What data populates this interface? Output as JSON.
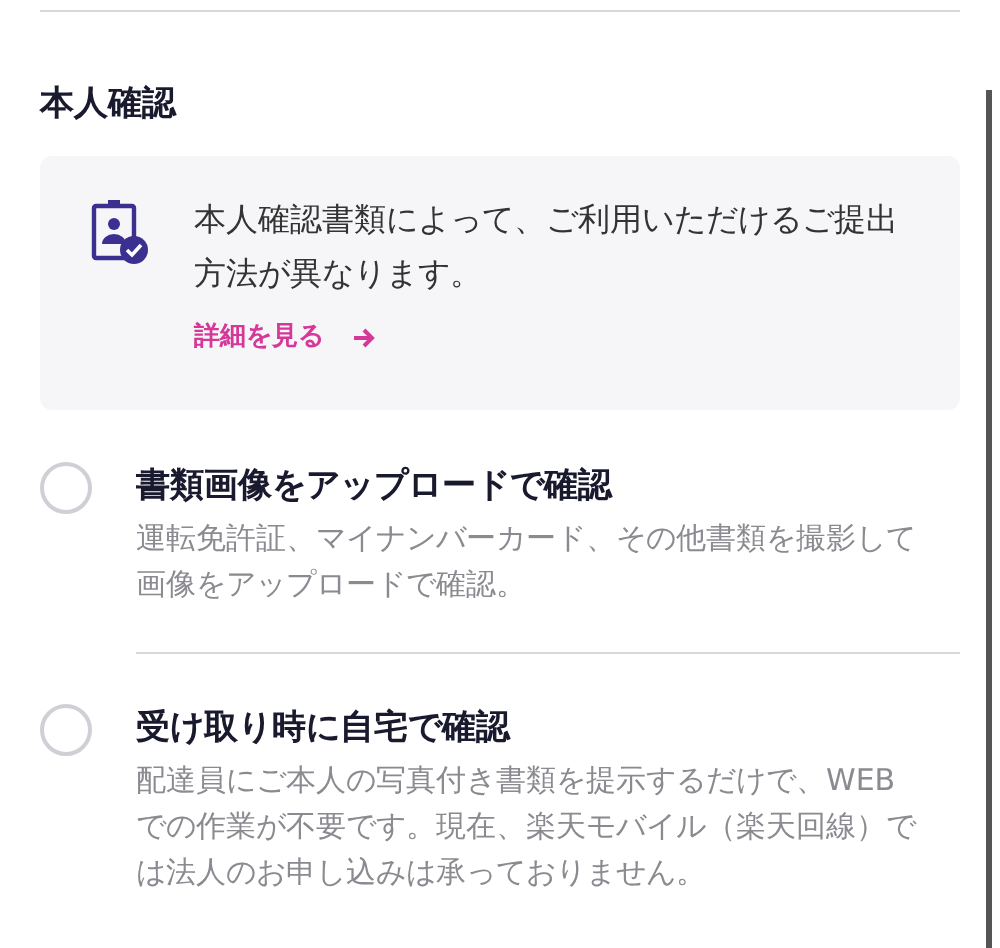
{
  "section_title": "本人確認",
  "info_card": {
    "message": "本人確認書類によって、ご利用いただけるご提出方法が異なります。",
    "link": "詳細を見る"
  },
  "options": [
    {
      "title": "書類画像をアップロードで確認",
      "description": "運転免許証、マイナンバーカード、その他書類を撮影して画像をアップロードで確認。",
      "selected": false
    },
    {
      "title": "受け取り時に自宅で確認",
      "description": "配達員にご本人の写真付き書類を提示するだけで、WEBでの作業が不要です。現在、楽天モバイル（楽天回線）では法人のお申し込みは承っておりません。",
      "selected": false
    }
  ]
}
